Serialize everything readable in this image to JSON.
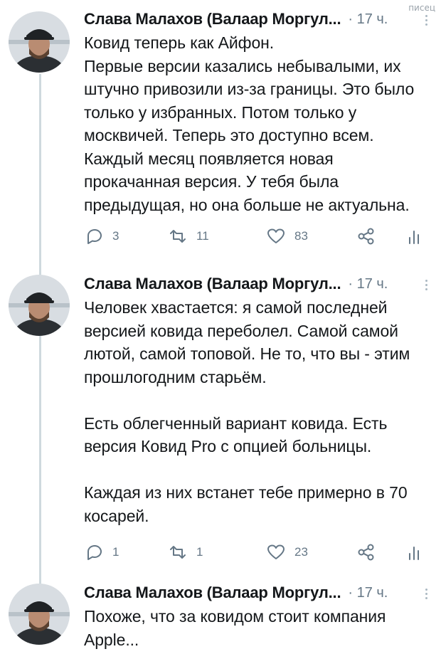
{
  "watermark": "писец",
  "tweets": [
    {
      "author": "Слава Малахов (Валаар Моргул...",
      "time": "· 17 ч.",
      "text": "Ковид теперь как Айфон.\nПервые версии казались небывалыми, их штучно привозили из-за границы. Это было только у избранных. Потом только у москвичей. Теперь это доступно всем. Каждый месяц появляется новая прокачанная версия. У тебя была предыдущая, но она больше не актуальна.",
      "replies": "3",
      "retweets": "11",
      "likes": "83"
    },
    {
      "author": "Слава Малахов (Валаар Моргул...",
      "time": "· 17 ч.",
      "text": "Человек хвастается: я самой последней версией ковида переболел. Самой самой лютой, самой топовой. Не то, что вы - этим прошлогодним старьём.\n\nЕсть облегченный вариант ковида. Есть версия Ковид Pro с опцией больницы.\n\nКаждая из них встанет тебе примерно в 70 косарей.",
      "replies": "1",
      "retweets": "1",
      "likes": "23"
    },
    {
      "author": "Слава Малахов (Валаар Моргул...",
      "time": "· 17 ч.",
      "text": "Похоже, что за ковидом стоит компания Apple..."
    }
  ],
  "icons": {
    "reply": "reply-icon",
    "retweet": "retweet-icon",
    "like": "heart-icon",
    "share": "share-icon",
    "stats": "stats-icon",
    "menu": "more-vertical-icon"
  },
  "colors": {
    "text": "#14171a",
    "secondary": "#657786",
    "thread_line": "#cfd9de"
  }
}
